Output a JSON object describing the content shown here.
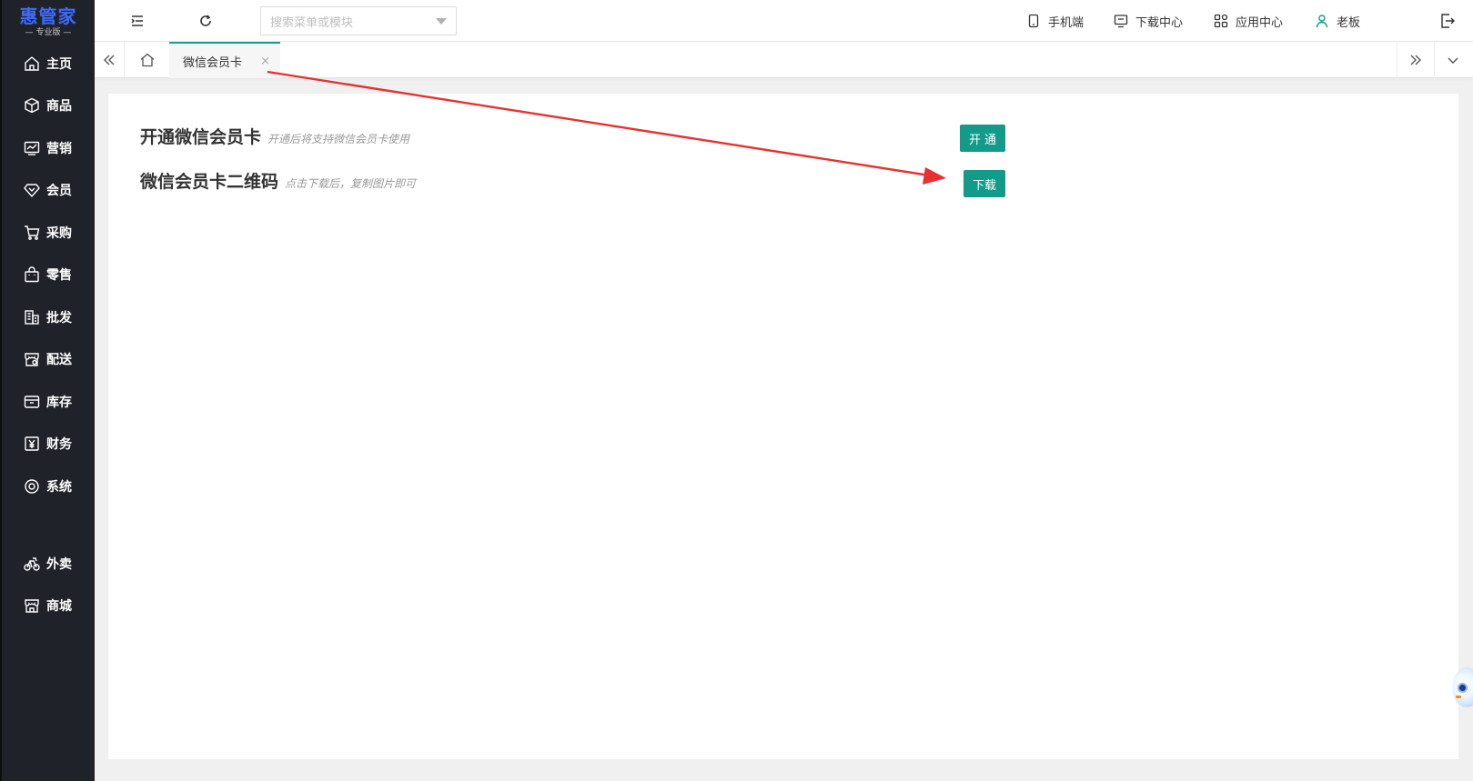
{
  "app": {
    "logo_title": "惠管家",
    "logo_sub": "— 专业版 —"
  },
  "sidebar": {
    "items": [
      {
        "label": "主页",
        "icon": "home-icon"
      },
      {
        "label": "商品",
        "icon": "box-icon"
      },
      {
        "label": "营销",
        "icon": "chart-icon"
      },
      {
        "label": "会员",
        "icon": "diamond-icon"
      },
      {
        "label": "采购",
        "icon": "cart-icon"
      },
      {
        "label": "零售",
        "icon": "bag-icon"
      },
      {
        "label": "批发",
        "icon": "building-icon"
      },
      {
        "label": "配送",
        "icon": "store-icon"
      },
      {
        "label": "库存",
        "icon": "inventory-icon"
      },
      {
        "label": "财务",
        "icon": "yen-icon"
      },
      {
        "label": "系统",
        "icon": "settings-icon"
      },
      {
        "label": "外卖",
        "icon": "bike-icon"
      },
      {
        "label": "商城",
        "icon": "shop-icon"
      }
    ]
  },
  "header": {
    "search_placeholder": "搜索菜单或模块",
    "links": {
      "mobile": "手机端",
      "download_center": "下载中心",
      "app_center": "应用中心",
      "user": "老板"
    }
  },
  "tabs": {
    "active_label": "微信会员卡",
    "close_glyph": "×"
  },
  "content": {
    "row1": {
      "title": "开通微信会员卡",
      "hint": "开通后将支持微信会员卡使用",
      "button": "开 通"
    },
    "row2": {
      "title": "微信会员卡二维码",
      "hint": "点击下载后，复制图片即可",
      "button": "下载"
    }
  },
  "colors": {
    "sidebar_bg": "#20222a",
    "accent": "#129b8a",
    "logo": "#3d6bff",
    "annotation_arrow": "#e8302f"
  }
}
